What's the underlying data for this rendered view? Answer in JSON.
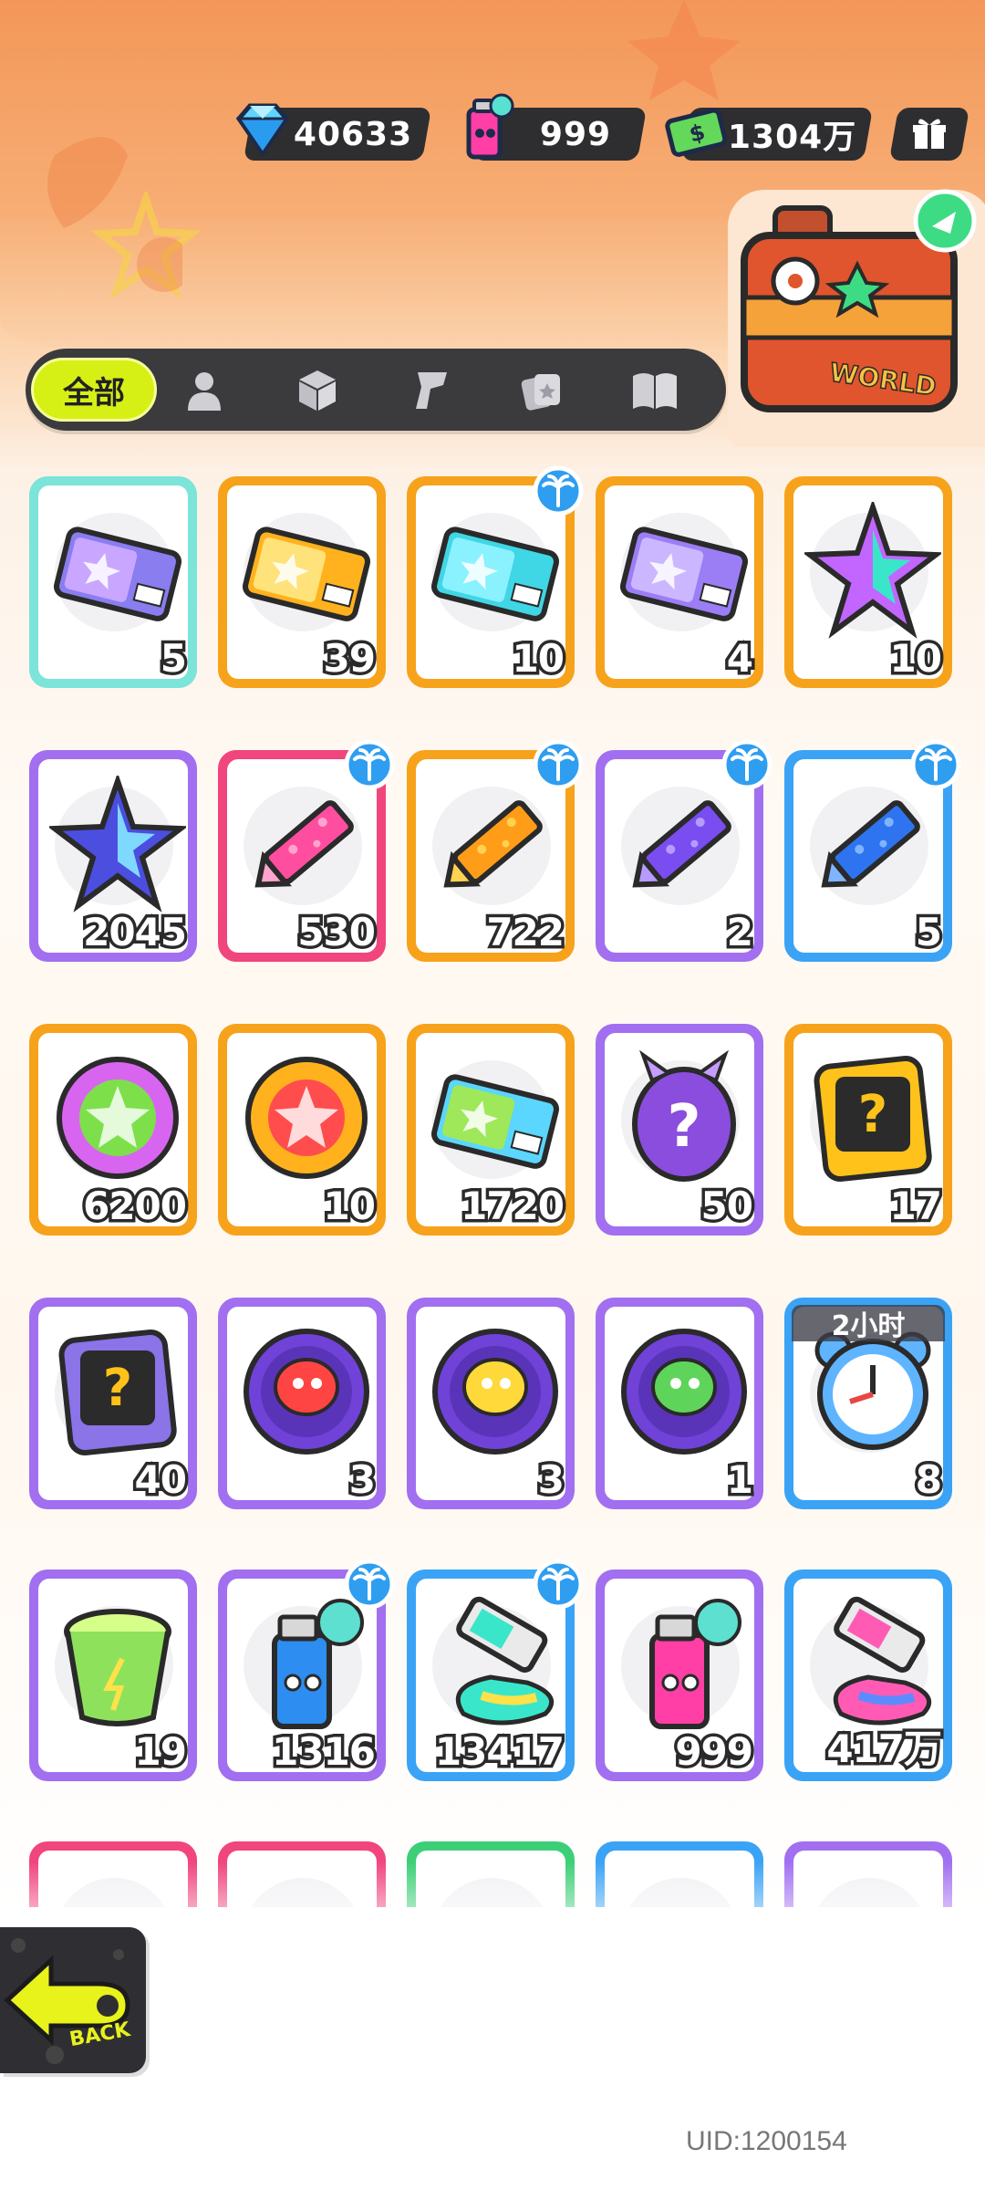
{
  "currencies": {
    "diamond": "40633",
    "paint_can": "999",
    "cash": "1304万"
  },
  "tabs": {
    "active_label": "全部",
    "icons": [
      "person-icon",
      "box-icon",
      "spray-gun-icon",
      "cards-icon",
      "book-icon"
    ]
  },
  "suitcase_label": "WORLD",
  "items": [
    {
      "qty": "5",
      "frame": "#7ce4d8",
      "icon": "purple-ticket-icon"
    },
    {
      "qty": "39",
      "frame": "#f7a21b",
      "icon": "gold-ticket-icon"
    },
    {
      "qty": "10",
      "frame": "#f7a21b",
      "icon": "wave-ticket-icon",
      "badge": true
    },
    {
      "qty": "4",
      "frame": "#f7a21b",
      "icon": "violet-ticket-icon"
    },
    {
      "qty": "10",
      "frame": "#f7a21b",
      "icon": "rainbow-star-icon"
    },
    {
      "qty": "2045",
      "frame": "#a16ff0",
      "icon": "blue-star-icon"
    },
    {
      "qty": "530",
      "frame": "#f0457d",
      "icon": "pink-crayon-icon",
      "badge": true
    },
    {
      "qty": "722",
      "frame": "#f7a21b",
      "icon": "orange-crayon-icon",
      "badge": true
    },
    {
      "qty": "2",
      "frame": "#a16ff0",
      "icon": "purple-crayon-icon",
      "badge": true
    },
    {
      "qty": "5",
      "frame": "#3aa3f5",
      "icon": "blue-crayon-icon",
      "badge": true
    },
    {
      "qty": "6200",
      "frame": "#f7a21b",
      "icon": "cool-badge-icon"
    },
    {
      "qty": "10",
      "frame": "#f7a21b",
      "icon": "star-burst-badge-icon"
    },
    {
      "qty": "1720",
      "frame": "#f7a21b",
      "icon": "season-ticket-icon"
    },
    {
      "qty": "50",
      "frame": "#a16ff0",
      "icon": "mystery-egg-icon"
    },
    {
      "qty": "17",
      "frame": "#f7a21b",
      "icon": "mystery-card-icon"
    },
    {
      "qty": "40",
      "frame": "#a16ff0",
      "icon": "travel-card-icon"
    },
    {
      "qty": "3",
      "frame": "#a16ff0",
      "icon": "red-fish-orb-icon"
    },
    {
      "qty": "3",
      "frame": "#a16ff0",
      "icon": "yellow-squid-orb-icon"
    },
    {
      "qty": "1",
      "frame": "#a16ff0",
      "icon": "green-sprout-orb-icon"
    },
    {
      "qty": "8",
      "frame": "#3aa3f5",
      "icon": "alarm-clock-icon",
      "timer": "2小时"
    },
    {
      "qty": "19",
      "frame": "#a16ff0",
      "icon": "green-cup-icon"
    },
    {
      "qty": "1316",
      "frame": "#a16ff0",
      "icon": "blue-spray-can-icon",
      "badge": true
    },
    {
      "qty": "13417",
      "frame": "#3aa3f5",
      "icon": "paint-tube-icon",
      "badge": true
    },
    {
      "qty": "999",
      "frame": "#a16ff0",
      "icon": "pink-spray-can-icon"
    },
    {
      "qty": "417万",
      "frame": "#3aa3f5",
      "icon": "rainbow-tube-icon"
    }
  ],
  "partial_row_frames": [
    "#f0457d",
    "#f0457d",
    "#3ccf78",
    "#3aa3f5",
    "#a16ff0"
  ],
  "back_label": "BACK",
  "uid": "UID:1200154"
}
